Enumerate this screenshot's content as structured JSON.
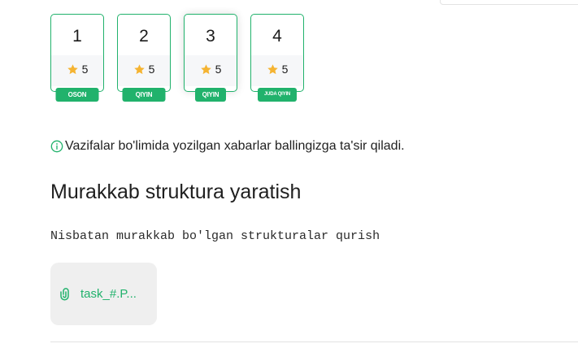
{
  "tasks": [
    {
      "number": "1",
      "score": "5",
      "difficulty": "OSON"
    },
    {
      "number": "2",
      "score": "5",
      "difficulty": "QIYIN"
    },
    {
      "number": "3",
      "score": "5",
      "difficulty": "QIYIN"
    },
    {
      "number": "4",
      "score": "5",
      "difficulty": "JUDA QIYIN"
    }
  ],
  "active_task": "3",
  "notice": {
    "icon": "info-icon",
    "text": "Vazifalar bo'limida yozilgan xabarlar ballingizga ta'sir qiladi."
  },
  "task": {
    "title": "Murakkab struktura yaratish",
    "description": "Nisbatan murakkab bo'lgan strukturalar qurish",
    "attachment": {
      "icon": "paperclip-icon",
      "name": "task_#.P..."
    }
  },
  "colors": {
    "accent": "#21b26c",
    "star": "#f5b432",
    "card_bottom": "#f6f7f9",
    "attachment_bg": "#efefef"
  }
}
